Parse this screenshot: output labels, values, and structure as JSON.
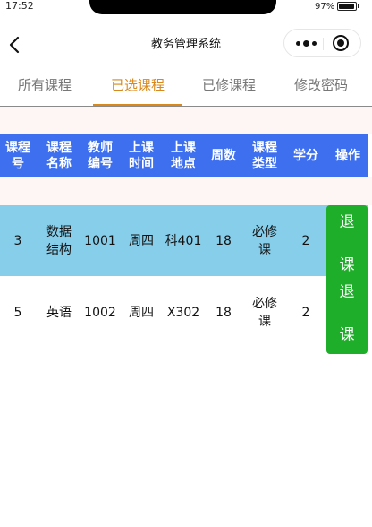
{
  "status_bar": {
    "time": "17:52",
    "battery": "97%",
    "battery_level": 0.97
  },
  "nav": {
    "title": "教务管理系统"
  },
  "tabs": [
    {
      "label": "所有课程"
    },
    {
      "label": "已选课程",
      "active": true
    },
    {
      "label": "已修课程"
    },
    {
      "label": "修改密码"
    }
  ],
  "table": {
    "headers": [
      "课程\n号",
      "课程\n名称",
      "教师\n编号",
      "上课\n时间",
      "上课\n地点",
      "周数",
      "课程\n类型",
      "学分",
      "操作"
    ],
    "rows": [
      {
        "course_no": "3",
        "course_name": "数据\n结构",
        "teacher_no": "1001",
        "time": "周四",
        "location": "科401",
        "weeks": "18",
        "type": "必修\n课",
        "credit": "2",
        "action": {
          "top": "退",
          "bottom": "课"
        }
      },
      {
        "course_no": "5",
        "course_name": "英语",
        "teacher_no": "1002",
        "time": "周四",
        "location": "X302",
        "weeks": "18",
        "type": "必修\n课",
        "credit": "2",
        "action": {
          "top": "退",
          "bottom": "课"
        }
      }
    ]
  },
  "colors": {
    "header_bg": "#3d6fee",
    "highlight_row": "#87ceea",
    "active_tab": "#d9891b",
    "action_button": "#1fae2a",
    "band_bg": "#fdf6f4"
  }
}
